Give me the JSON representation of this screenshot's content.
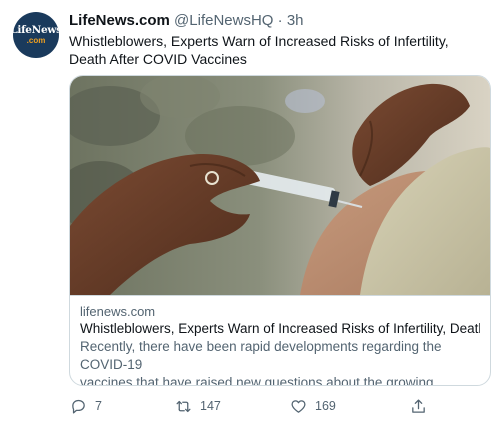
{
  "tweet": {
    "avatar": {
      "line1": "LifeNews",
      "line2": ".com",
      "color": "#1a3a5c"
    },
    "author_name": "LifeNews.com",
    "handle": "@LifeNewsHQ",
    "separator": "·",
    "time": "3h",
    "text": "Whistleblowers, Experts Warn of Increased Risks of Infertility, Death After COVID Vaccines"
  },
  "card": {
    "image_description": "vaccine-injection-photo",
    "domain": "lifenews.com",
    "title": "Whistleblowers, Experts Warn of Increased Risks of Infertility, Death Aft...",
    "description_line1": "Recently, there have been rapid developments regarding the COVID-19",
    "description_line2": "vaccines that have raised new questions about the growing number of ..."
  },
  "actions": {
    "reply_count": "7",
    "retweet_count": "147",
    "like_count": "169",
    "reply_icon": "reply-icon",
    "retweet_icon": "retweet-icon",
    "like_icon": "heart-icon",
    "share_icon": "share-icon"
  },
  "colors": {
    "secondary_text": "#536471",
    "border": "#cfd9de",
    "primary_text": "#0f1419"
  }
}
